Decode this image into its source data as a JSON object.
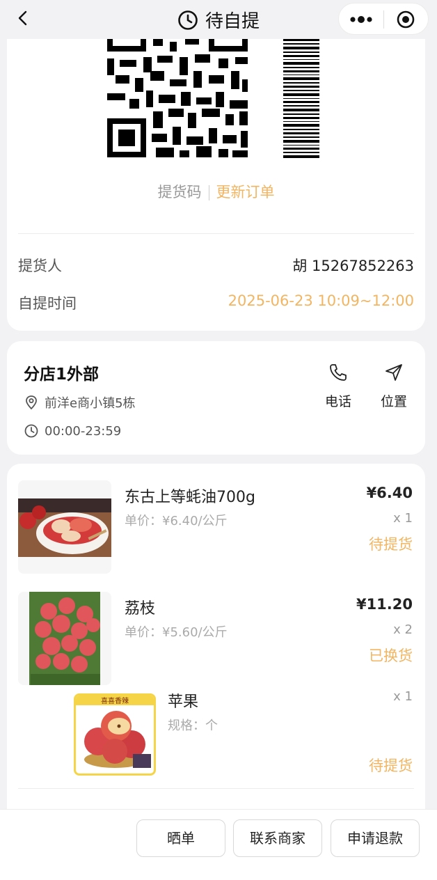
{
  "nav": {
    "title": "待自提"
  },
  "pickup": {
    "code_label": "提货码",
    "update_link": "更新订单",
    "contact_key": "提货人",
    "contact_value": "胡  15267852263",
    "time_key": "自提时间",
    "time_value": "2025-06-23 10:09~12:00"
  },
  "store": {
    "name": "分店1外部",
    "address": "前洋e商小镇5栋",
    "hours": "00:00-23:59",
    "phone_label": "电话",
    "location_label": "位置"
  },
  "products": [
    {
      "name": "东古上等蚝油700g",
      "sub": "单价：¥6.40/公斤",
      "price": "¥6.40",
      "qty": "x 1",
      "status": "待提货"
    },
    {
      "name": "荔枝",
      "sub": "单价：¥5.60/公斤",
      "price": "¥11.20",
      "qty": "x 2",
      "status": "已换货"
    },
    {
      "name": "苹果",
      "sub": "规格：个",
      "qty": "x 1",
      "status": "待提货",
      "banner": "喜喜香辣"
    }
  ],
  "actions": {
    "share": "晒单",
    "contact": "联系商家",
    "refund": "申请退款"
  },
  "colors": {
    "accent": "#f2b562",
    "background": "#f2f2f4"
  }
}
